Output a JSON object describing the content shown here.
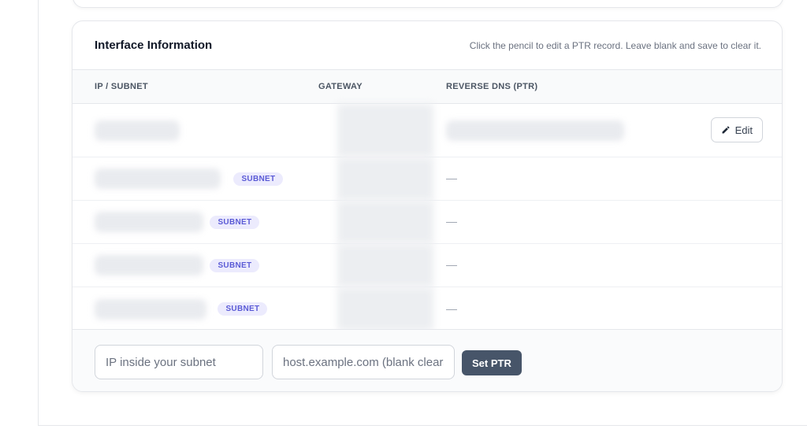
{
  "card": {
    "title": "Interface Information",
    "hint": "Click the pencil to edit a PTR record. Leave blank and save to clear it."
  },
  "table": {
    "columns": [
      "IP / SUBNET",
      "GATEWAY",
      "REVERSE DNS (PTR)"
    ],
    "rows": [
      {
        "badge": "",
        "ptr": "",
        "has_edit": true
      },
      {
        "badge": "SUBNET",
        "ptr": "—"
      },
      {
        "badge": "SUBNET",
        "ptr": "—"
      },
      {
        "badge": "SUBNET",
        "ptr": "—"
      },
      {
        "badge": "SUBNET",
        "ptr": "—"
      }
    ],
    "edit_label": "Edit"
  },
  "form": {
    "ip_placeholder": "IP inside your subnet",
    "host_placeholder": "host.example.com (blank clears)",
    "submit_label": "Set PTR"
  },
  "icons": {
    "edit": "pencil-icon"
  }
}
